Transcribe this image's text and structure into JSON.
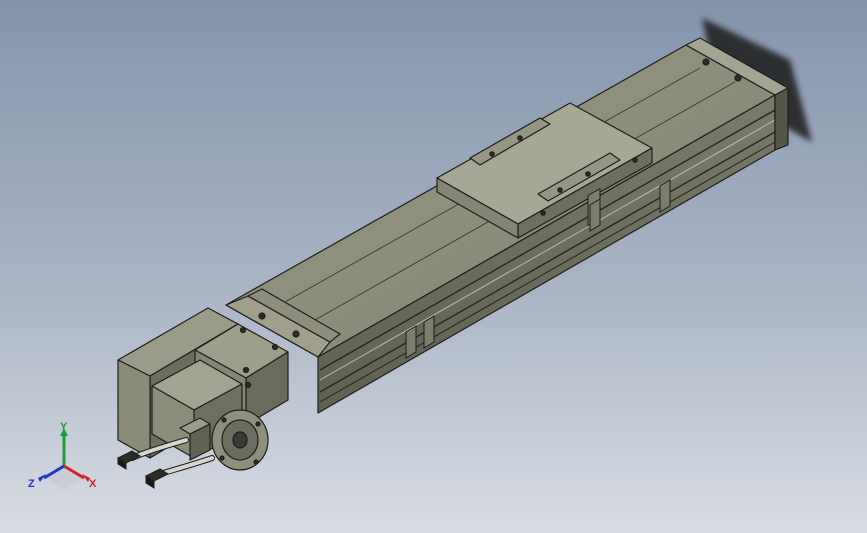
{
  "viewport": {
    "background_top": "#8494ad",
    "background_bottom": "#d9dde4"
  },
  "model": {
    "name": "linear-actuator-module",
    "body_color": "#8b8c7a",
    "edge_color": "#1e1e1a",
    "dark_color": "#2c2d27"
  },
  "triad": {
    "y_label": "Y",
    "x_label": "X",
    "z_label": "Z",
    "y_color": "#1f9b3a",
    "x_color": "#d2231b",
    "z_color": "#2233cc"
  }
}
